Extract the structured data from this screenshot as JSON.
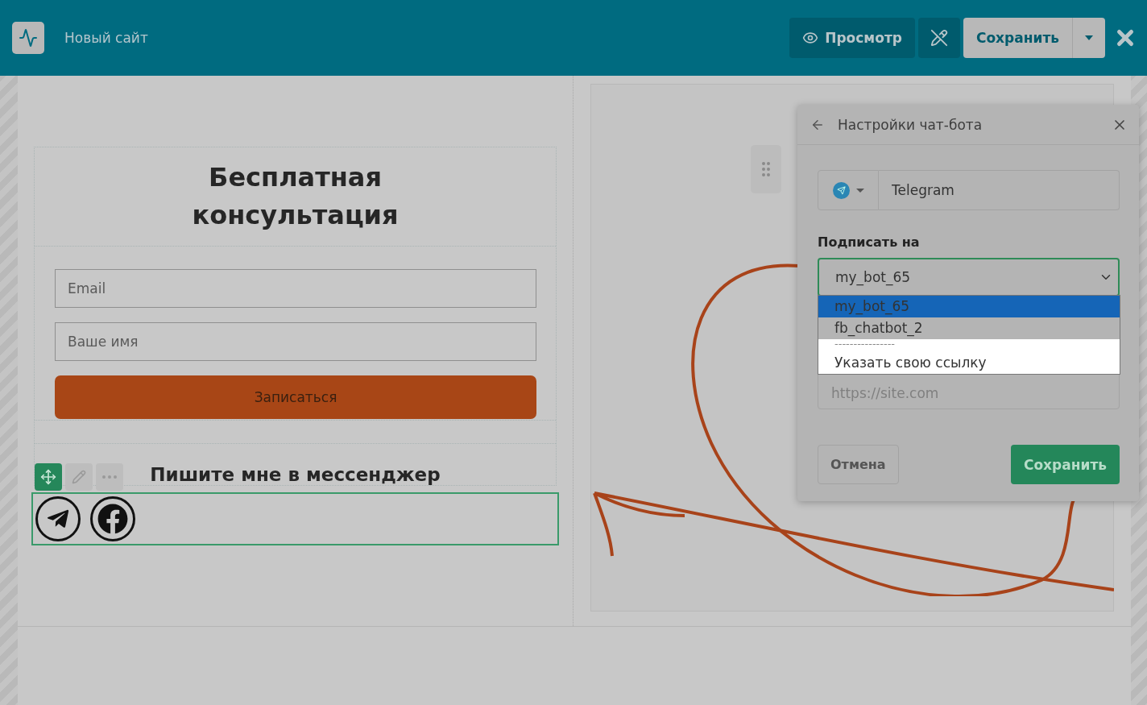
{
  "header": {
    "site_name": "Новый сайт",
    "preview_button": "Просмотр",
    "save_button": "Сохранить"
  },
  "form": {
    "heading": "Бесплатная консультация",
    "fields": [
      {
        "placeholder": "Email"
      },
      {
        "placeholder": "Ваше имя"
      }
    ],
    "submit": "Записаться",
    "messenger_heading": "Пишите мне в мессенджер"
  },
  "modal": {
    "title": "Настройки чат-бота",
    "channel": {
      "value": "Telegram"
    },
    "subscribe_label": "Подписать на",
    "select": {
      "value": "my_bot_65"
    },
    "options": [
      {
        "kind": "bot",
        "label": "my_bot_65",
        "selected": true
      },
      {
        "kind": "bot",
        "label": "fb_chatbot_2",
        "selected": false
      },
      {
        "kind": "separator",
        "label": "----------------",
        "selected": false
      },
      {
        "kind": "custom",
        "label": "Указать свою ссылку",
        "selected": false
      }
    ],
    "url_field": {
      "placeholder": "https://site.com"
    },
    "cancel_button": "Отмена",
    "save_button": "Сохранить"
  }
}
